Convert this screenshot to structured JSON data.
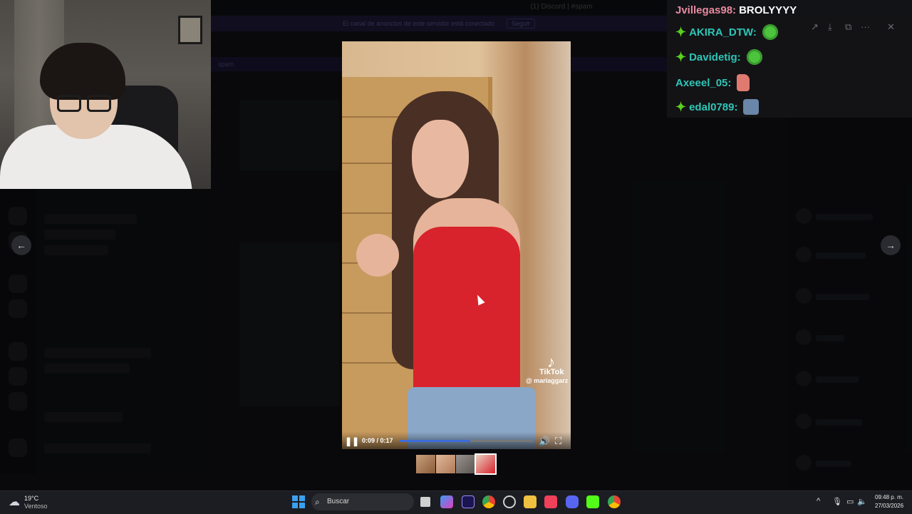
{
  "discord_bg": {
    "window_title": "(1) Discord | #spam",
    "banner_text": "El canal de anuncios de este servidor está conectado",
    "banner_button": "Seguir",
    "channel_header": "spam"
  },
  "chat": {
    "messages": [
      {
        "user": "Jvillegas98:",
        "text": "BROLYYYY",
        "badge": false,
        "emote": ""
      },
      {
        "user": "AKIRA_DTW:",
        "text": "",
        "badge": true,
        "emote": "green-face-emote"
      },
      {
        "user": "Davidetig:",
        "text": "",
        "badge": true,
        "emote": "green-face-emote"
      },
      {
        "user": "Axeeel_05:",
        "text": "",
        "badge": false,
        "emote": "patrick-emote"
      },
      {
        "user": "edal0789:",
        "text": "",
        "badge": true,
        "emote": "man-emote"
      }
    ]
  },
  "viewer": {
    "prev_arrow": "←",
    "next_arrow": "→",
    "download_icon": "⤓",
    "open_icon": "⧉",
    "more_icon": "···",
    "close_icon": "✕",
    "forward_icon": "↗"
  },
  "video": {
    "watermark_brand": "TikTok",
    "watermark_user": "@ mariaggarz",
    "time_display": "0:09 / 0:17",
    "progress_fraction": 0.53,
    "pause_glyph": "❚❚",
    "volume_glyph": "🔊",
    "fullscreen_glyph": "⛶",
    "thumbnail_count": 4
  },
  "taskbar": {
    "weather_temp": "19°C",
    "weather_desc": "Ventoso",
    "search_placeholder": "Buscar",
    "clock_time": "09:48 p. m.",
    "clock_date": "27/03/2026"
  },
  "colors": {
    "accent_blue": "#3d6bd8",
    "badge_green": "#59d020",
    "username_teal": "#2ec5b6",
    "username_pink": "#e88aa0"
  }
}
